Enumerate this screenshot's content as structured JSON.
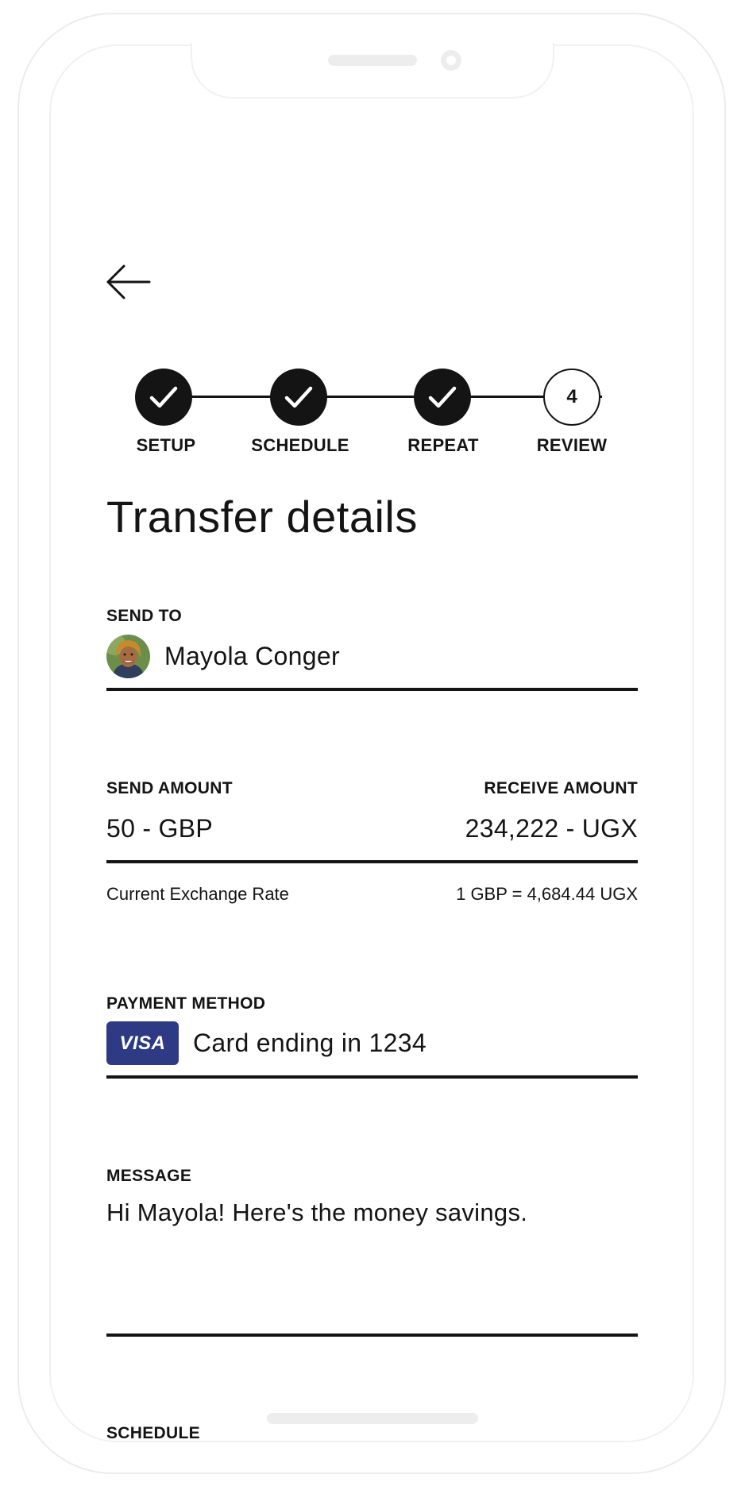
{
  "stepper": {
    "steps": [
      {
        "label": "SETUP",
        "status": "done"
      },
      {
        "label": "SCHEDULE",
        "status": "done"
      },
      {
        "label": "REPEAT",
        "status": "done"
      },
      {
        "label": "REVIEW",
        "status": "current",
        "number": "4"
      }
    ]
  },
  "page": {
    "title": "Transfer details"
  },
  "send_to": {
    "label": "SEND TO",
    "recipient_name": "Mayola Conger"
  },
  "amounts": {
    "send_label": "SEND AMOUNT",
    "send_value": "50 - GBP",
    "receive_label": "RECEIVE AMOUNT",
    "receive_value": "234,222 - UGX",
    "rate_label": "Current Exchange Rate",
    "rate_value": "1 GBP = 4,684.44 UGX"
  },
  "payment": {
    "label": "PAYMENT METHOD",
    "card_brand": "VISA",
    "card_text": "Card ending in 1234"
  },
  "message": {
    "label": "MESSAGE",
    "text": "Hi Mayola! Here's the money savings."
  },
  "schedule": {
    "label": "SCHEDULE"
  },
  "icons": {
    "back": "arrow-left-icon",
    "check": "checkmark-icon"
  },
  "colors": {
    "primary": "#141414",
    "visa_blue": "#2e3a84",
    "visa_gold": "#f4b526"
  }
}
